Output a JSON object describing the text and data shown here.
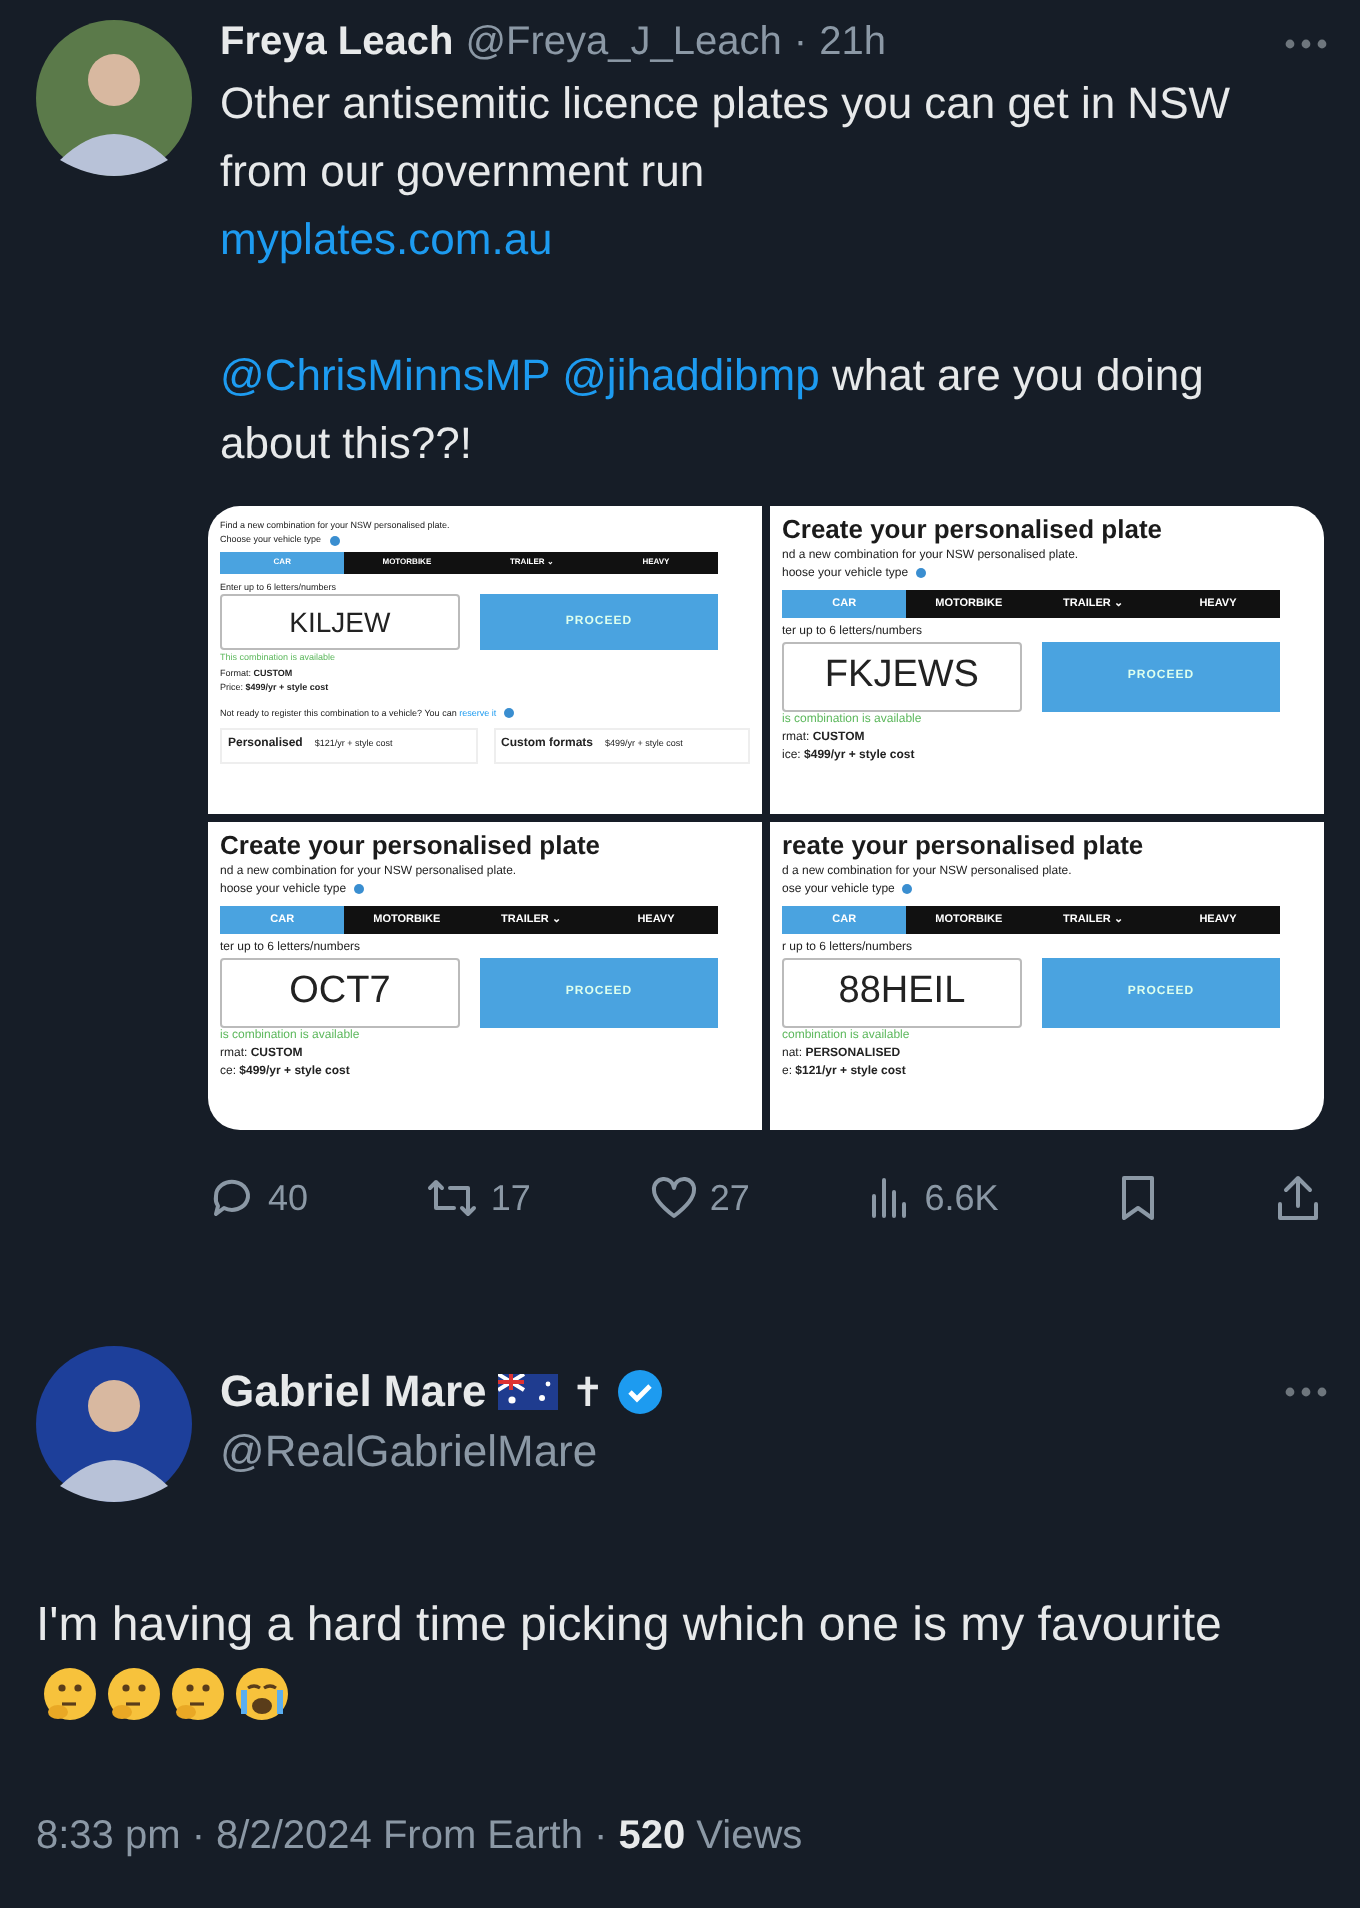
{
  "post": {
    "name": "Freya Leach",
    "handle": "@Freya_J_Leach",
    "separator": "·",
    "time": "21h",
    "text": "Other antisemitic licence plates you can get in NSW from our government run",
    "link": "myplates.com.au",
    "mentions": [
      "@ChrisMinnsMP",
      "@jihaddibmp"
    ],
    "question": "what are you doing about this??!",
    "images": [
      {
        "subtitle": "Find a new combination for your NSW personalised plate.",
        "vehicle_label": "Choose your vehicle type",
        "tabs": [
          {
            "label": "CAR",
            "selected": true
          },
          {
            "label": "MOTORBIKE",
            "selected": false
          },
          {
            "label": "TRAILER ⌄",
            "selected": false
          },
          {
            "label": "HEAVY",
            "selected": false
          }
        ],
        "entry_label": "Enter up to 6 letters/numbers",
        "plate": "KILJEW",
        "button": "PROCEED",
        "availability": "This combination is available",
        "format": "Format: **CUSTOM**",
        "price": "Price: **$499/yr + style cost**",
        "reserve_note": "Not ready to register this combination to a vehicle? You can",
        "reserve_link": "reserve it",
        "format_options": [
          {
            "name": "Personalised",
            "price": "$121/yr + style cost"
          },
          {
            "name": "Custom formats",
            "price": "$499/yr + style cost"
          }
        ]
      },
      {
        "title": "Create your personalised plate",
        "subtitle": "nd a new combination for your NSW personalised plate.",
        "vehicle_label": "hoose your vehicle type",
        "tabs": [
          {
            "label": "CAR",
            "selected": true
          },
          {
            "label": "MOTORBIKE",
            "selected": false
          },
          {
            "label": "TRAILER ⌄",
            "selected": false
          },
          {
            "label": "HEAVY",
            "selected": false
          }
        ],
        "entry_label": "ter up to 6 letters/numbers",
        "plate": "FKJEWS",
        "button": "PROCEED",
        "availability": "is combination is available",
        "format": "rmat: **CUSTOM**",
        "price": "ice: **$499/yr + style cost**"
      },
      {
        "title": "Create your personalised plate",
        "subtitle": "nd a new combination for your NSW personalised plate.",
        "vehicle_label": "hoose your vehicle type",
        "tabs": [
          {
            "label": "CAR",
            "selected": true
          },
          {
            "label": "MOTORBIKE",
            "selected": false
          },
          {
            "label": "TRAILER ⌄",
            "selected": false
          },
          {
            "label": "HEAVY",
            "selected": false
          }
        ],
        "entry_label": "ter up to 6 letters/numbers",
        "plate": "OCT7",
        "button": "PROCEED",
        "availability": "is combination is available",
        "format": "rmat: **CUSTOM**",
        "price": "ce: **$499/yr + style cost**"
      },
      {
        "title": "reate your personalised plate",
        "subtitle": "d a new combination for your NSW personalised plate.",
        "vehicle_label": "ose your vehicle type",
        "tabs": [
          {
            "label": "CAR",
            "selected": true
          },
          {
            "label": "MOTORBIKE",
            "selected": false
          },
          {
            "label": "TRAILER ⌄",
            "selected": false
          },
          {
            "label": "HEAVY",
            "selected": false
          }
        ],
        "entry_label": "r up to 6 letters/numbers",
        "plate": "88HEIL",
        "button": "PROCEED",
        "availability": "combination is available",
        "format": "nat: **PERSONALISED**",
        "price": "e: **$121/yr + style cost**"
      }
    ],
    "actions": [
      {
        "kind": "reply",
        "count": "40"
      },
      {
        "kind": "repost",
        "count": "17"
      },
      {
        "kind": "like",
        "count": "27"
      },
      {
        "kind": "views",
        "count": "6.6K"
      },
      {
        "kind": "bookmark"
      },
      {
        "kind": "share"
      }
    ]
  },
  "reply": {
    "name": "Gabriel Mare",
    "badge": "✝",
    "handle": "@RealGabrielMare",
    "text": "I'm having a hard time picking which one is my favourite",
    "emojis": [
      {
        "kind": "thinking"
      },
      {
        "kind": "thinking"
      },
      {
        "kind": "thinking"
      },
      {
        "kind": "crying"
      }
    ],
    "footer": "8:33 pm · 8/2/2024 From Earth · **520** Views"
  }
}
